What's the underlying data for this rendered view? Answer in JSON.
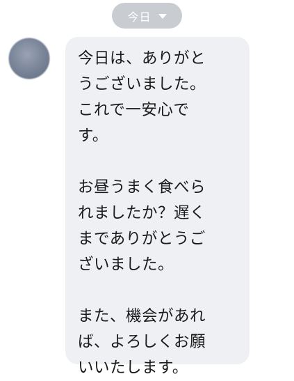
{
  "date_separator": {
    "label": "今日"
  },
  "message": {
    "lines": [
      "今日は、ありがと",
      "うございました。",
      "これで一安心で",
      "す。",
      "",
      "お昼うまく食べら",
      "れましたか？遅く",
      "までありがとうご",
      "ざいました。",
      "",
      "また、機会があれ",
      "ば、よろしくお願",
      "いいたします。"
    ]
  }
}
